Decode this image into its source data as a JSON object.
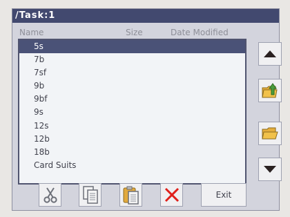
{
  "window": {
    "title": "/Task:1"
  },
  "columns": {
    "name": "Name",
    "size": "Size",
    "date_modified": "Date Modified"
  },
  "files": [
    "5s",
    "7b",
    "7sf",
    "9b",
    "9bf",
    "9s",
    "12s",
    "12b",
    "18b",
    "Card Suits"
  ],
  "selected_file": "5s",
  "side_buttons": [
    {
      "icon": "scroll-up-icon"
    },
    {
      "icon": "folder-up-icon"
    },
    {
      "icon": "open-folder-icon"
    },
    {
      "icon": "scroll-down-icon"
    }
  ],
  "toolbar": {
    "cut_icon": "scissors-icon",
    "copy_icon": "copy-icon",
    "paste_icon": "paste-icon",
    "delete_icon": "delete-x-icon",
    "exit_label": "Exit"
  },
  "colors": {
    "titlebar": "#42496f",
    "selection": "#4a5277",
    "delete_red": "#e0201b",
    "folder_yellow": "#f1c14a",
    "arrow_green": "#4a9d3d"
  }
}
